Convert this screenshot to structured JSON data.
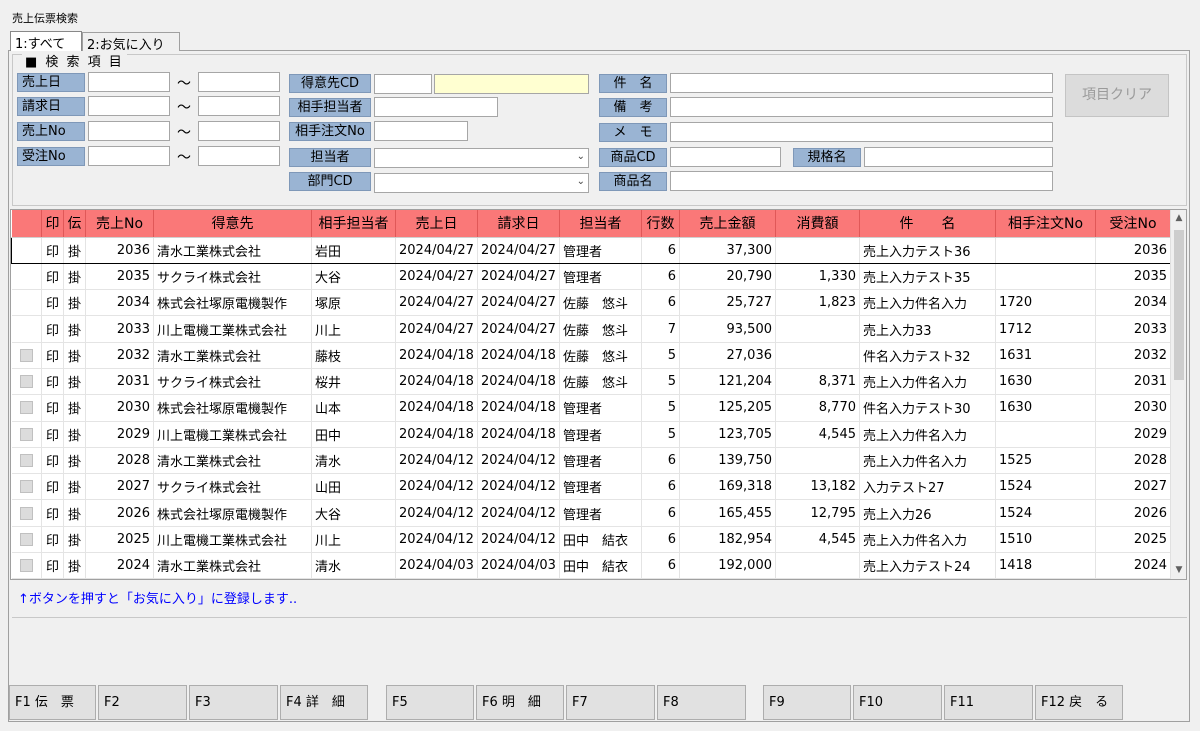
{
  "window": {
    "title": "売上伝票検索"
  },
  "tabs": [
    {
      "label": "1:すべて",
      "active": true
    },
    {
      "label": "2:お気に入り",
      "active": false
    }
  ],
  "search": {
    "section_title": "■ 検 索 項 目",
    "tilde": "～",
    "uriage_bi": "売上日",
    "seikyu_bi": "請求日",
    "uriage_no": "売上No",
    "juchu_no": "受注No",
    "tokuisaki_cd": "得意先CD",
    "aite_tantosha": "相手担当者",
    "aite_chumon_no": "相手注文No",
    "tantosha": "担当者",
    "bumon_cd": "部門CD",
    "kenmei": "件　名",
    "biko": "備　考",
    "memo": "メ　モ",
    "shohin_cd": "商品CD",
    "kikaku_mei": "規格名",
    "shohin_mei": "商品名",
    "clear_button": "項目クリア",
    "dropdown_arrow": "⌄"
  },
  "grid": {
    "headers": [
      "",
      "印",
      "伝",
      "売上No",
      "得意先",
      "相手担当者",
      "売上日",
      "請求日",
      "担当者",
      "行数",
      "売上金額",
      "消費額",
      "件　　名",
      "相手注文No",
      "受注No"
    ],
    "rows": [
      {
        "chk": false,
        "in": "印",
        "den": "掛",
        "no": "2036",
        "tokuisaki": "清水工業株式会社",
        "aite": "岩田",
        "uriage_bi": "2024/04/27",
        "seikyu_bi": "2024/04/27",
        "tantosha": "管理者",
        "gyosu": "6",
        "kingaku": "37,300",
        "shohi": "",
        "kenmei": "売上入力テスト36",
        "chumon": "",
        "juchu": "2036"
      },
      {
        "chk": false,
        "in": "印",
        "den": "掛",
        "no": "2035",
        "tokuisaki": "サクライ株式会社",
        "aite": "大谷",
        "uriage_bi": "2024/04/27",
        "seikyu_bi": "2024/04/27",
        "tantosha": "管理者",
        "gyosu": "6",
        "kingaku": "20,790",
        "shohi": "1,330",
        "kenmei": "売上入力テスト35",
        "chumon": "",
        "juchu": "2035"
      },
      {
        "chk": false,
        "in": "印",
        "den": "掛",
        "no": "2034",
        "tokuisaki": "株式会社塚原電機製作",
        "aite": "塚原",
        "uriage_bi": "2024/04/27",
        "seikyu_bi": "2024/04/27",
        "tantosha": "佐藤　悠斗",
        "gyosu": "6",
        "kingaku": "25,727",
        "shohi": "1,823",
        "kenmei": "売上入力件名入力",
        "chumon": "1720",
        "juchu": "2034"
      },
      {
        "chk": false,
        "in": "印",
        "den": "掛",
        "no": "2033",
        "tokuisaki": "川上電機工業株式会社",
        "aite": "川上",
        "uriage_bi": "2024/04/27",
        "seikyu_bi": "2024/04/27",
        "tantosha": "佐藤　悠斗",
        "gyosu": "7",
        "kingaku": "93,500",
        "shohi": "",
        "kenmei": "売上入力33",
        "chumon": "1712",
        "juchu": "2033"
      },
      {
        "chk": true,
        "in": "印",
        "den": "掛",
        "no": "2032",
        "tokuisaki": "清水工業株式会社",
        "aite": "藤枝",
        "uriage_bi": "2024/04/18",
        "seikyu_bi": "2024/04/18",
        "tantosha": "佐藤　悠斗",
        "gyosu": "5",
        "kingaku": "27,036",
        "shohi": "",
        "kenmei": "件名入力テスト32",
        "chumon": "1631",
        "juchu": "2032"
      },
      {
        "chk": true,
        "in": "印",
        "den": "掛",
        "no": "2031",
        "tokuisaki": "サクライ株式会社",
        "aite": "桜井",
        "uriage_bi": "2024/04/18",
        "seikyu_bi": "2024/04/18",
        "tantosha": "佐藤　悠斗",
        "gyosu": "5",
        "kingaku": "121,204",
        "shohi": "8,371",
        "kenmei": "売上入力件名入力",
        "chumon": "1630",
        "juchu": "2031"
      },
      {
        "chk": true,
        "in": "印",
        "den": "掛",
        "no": "2030",
        "tokuisaki": "株式会社塚原電機製作",
        "aite": "山本",
        "uriage_bi": "2024/04/18",
        "seikyu_bi": "2024/04/18",
        "tantosha": "管理者",
        "gyosu": "5",
        "kingaku": "125,205",
        "shohi": "8,770",
        "kenmei": "件名入力テスト30",
        "chumon": "1630",
        "juchu": "2030"
      },
      {
        "chk": true,
        "in": "印",
        "den": "掛",
        "no": "2029",
        "tokuisaki": "川上電機工業株式会社",
        "aite": "田中",
        "uriage_bi": "2024/04/18",
        "seikyu_bi": "2024/04/18",
        "tantosha": "管理者",
        "gyosu": "5",
        "kingaku": "123,705",
        "shohi": "4,545",
        "kenmei": "売上入力件名入力",
        "chumon": "",
        "juchu": "2029"
      },
      {
        "chk": true,
        "in": "印",
        "den": "掛",
        "no": "2028",
        "tokuisaki": "清水工業株式会社",
        "aite": "清水",
        "uriage_bi": "2024/04/12",
        "seikyu_bi": "2024/04/12",
        "tantosha": "管理者",
        "gyosu": "6",
        "kingaku": "139,750",
        "shohi": "",
        "kenmei": "売上入力件名入力",
        "chumon": "1525",
        "juchu": "2028"
      },
      {
        "chk": true,
        "in": "印",
        "den": "掛",
        "no": "2027",
        "tokuisaki": "サクライ株式会社",
        "aite": "山田",
        "uriage_bi": "2024/04/12",
        "seikyu_bi": "2024/04/12",
        "tantosha": "管理者",
        "gyosu": "6",
        "kingaku": "169,318",
        "shohi": "13,182",
        "kenmei": "入力テスト27",
        "chumon": "1524",
        "juchu": "2027"
      },
      {
        "chk": true,
        "in": "印",
        "den": "掛",
        "no": "2026",
        "tokuisaki": "株式会社塚原電機製作",
        "aite": "大谷",
        "uriage_bi": "2024/04/12",
        "seikyu_bi": "2024/04/12",
        "tantosha": "管理者",
        "gyosu": "6",
        "kingaku": "165,455",
        "shohi": "12,795",
        "kenmei": "売上入力26",
        "chumon": "1524",
        "juchu": "2026"
      },
      {
        "chk": true,
        "in": "印",
        "den": "掛",
        "no": "2025",
        "tokuisaki": "川上電機工業株式会社",
        "aite": "川上",
        "uriage_bi": "2024/04/12",
        "seikyu_bi": "2024/04/12",
        "tantosha": "田中　結衣",
        "gyosu": "6",
        "kingaku": "182,954",
        "shohi": "4,545",
        "kenmei": "売上入力件名入力",
        "chumon": "1510",
        "juchu": "2025"
      },
      {
        "chk": true,
        "in": "印",
        "den": "掛",
        "no": "2024",
        "tokuisaki": "清水工業株式会社",
        "aite": "清水",
        "uriage_bi": "2024/04/03",
        "seikyu_bi": "2024/04/03",
        "tantosha": "田中　結衣",
        "gyosu": "6",
        "kingaku": "192,000",
        "shohi": "",
        "kenmei": "売上入力テスト24",
        "chumon": "1418",
        "juchu": "2024"
      }
    ],
    "scroll_up": "▲",
    "scroll_down": "▼"
  },
  "hint": "↑ボタンを押すと「お気に入り」に登録します..",
  "function_keys": [
    "F1 伝　票",
    "F2",
    "F3",
    "F4 詳　細",
    "F5",
    "F6 明　細",
    "F7",
    "F8",
    "F9",
    "F10",
    "F11",
    "F12 戻　る"
  ]
}
